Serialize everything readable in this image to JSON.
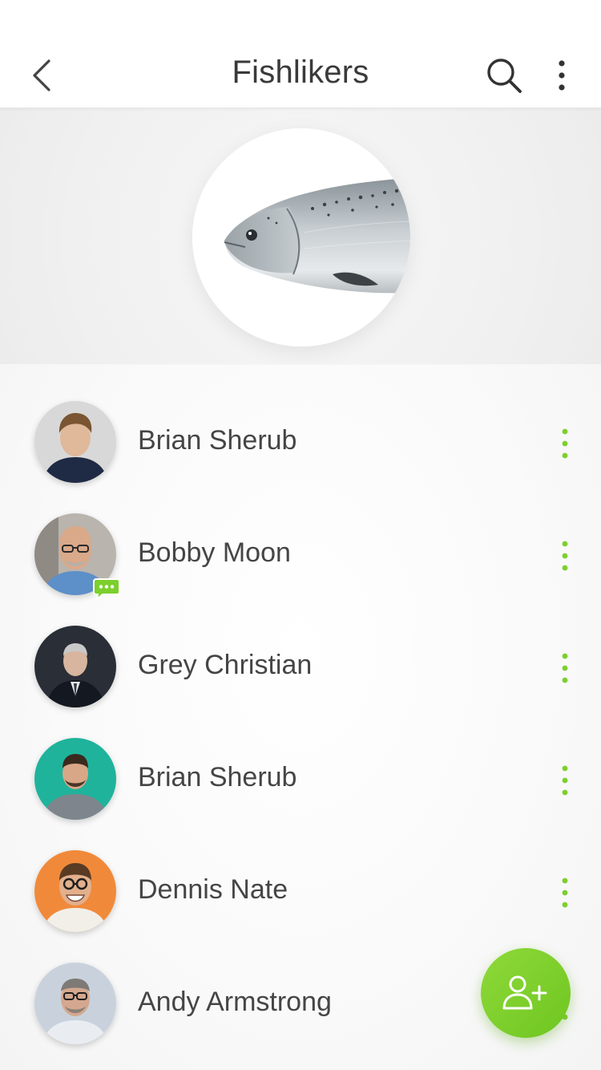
{
  "header": {
    "title": "Fishlikers",
    "back_icon": "chevron-left-icon",
    "search_icon": "search-icon",
    "more_icon": "more-vertical-icon"
  },
  "group": {
    "avatar_icon": "fish-image"
  },
  "members": [
    {
      "name": "Brian Sherub",
      "avatar_bg": "#d8d8d8",
      "shirt": "#1f2a44",
      "skin": "#e0b89a",
      "hair": "#7a5532",
      "chat_badge": false
    },
    {
      "name": "Bobby Moon",
      "avatar_bg": "#b9b4ad",
      "shirt": "#5d8fc9",
      "skin": "#d9a98a",
      "hair": "#d9a98a",
      "chat_badge": true
    },
    {
      "name": "Grey Christian",
      "avatar_bg": "#2a2e36",
      "shirt": "#141820",
      "skin": "#d7b59e",
      "hair": "#c8c8c8",
      "chat_badge": false
    },
    {
      "name": "Brian Sherub",
      "avatar_bg": "#1fb39c",
      "shirt": "#7f858c",
      "skin": "#d8a788",
      "hair": "#3a2a1e",
      "chat_badge": false
    },
    {
      "name": "Dennis Nate",
      "avatar_bg": "#f08a3a",
      "shirt": "#f2efe9",
      "skin": "#e2b08d",
      "hair": "#5a3b24",
      "chat_badge": false
    },
    {
      "name": "Andy Armstrong",
      "avatar_bg": "#c9d2dc",
      "shirt": "#e9edf2",
      "skin": "#d4a88f",
      "hair": "#7e7a76",
      "chat_badge": false
    }
  ],
  "colors": {
    "accent": "#7ccf2c",
    "title": "#3a3a3a",
    "name": "#454545"
  },
  "fab": {
    "icon": "add-user-icon"
  }
}
